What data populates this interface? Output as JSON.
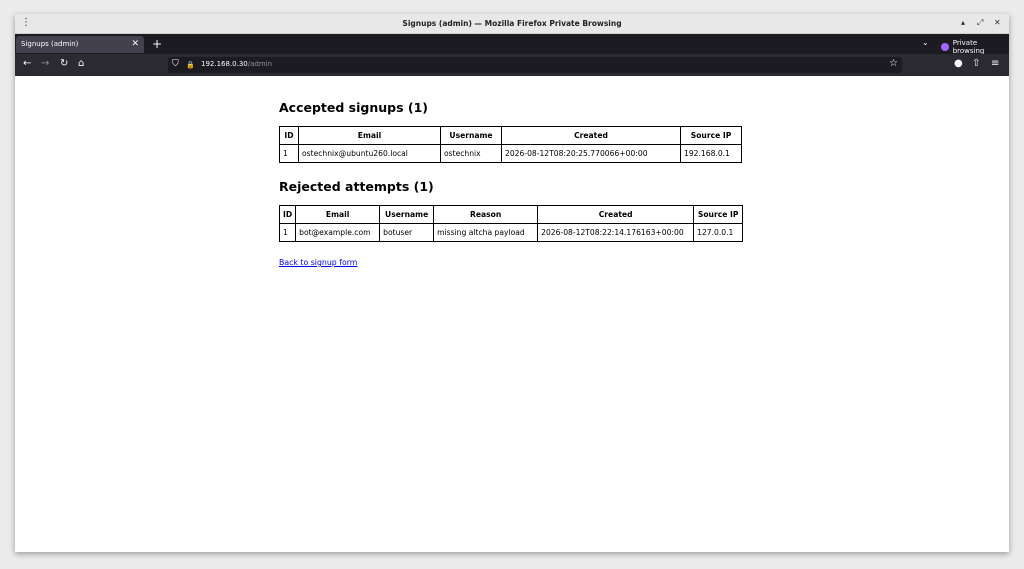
{
  "window": {
    "title": "Signups (admin) — Mozilla Firefox Private Browsing",
    "menu_icon": "⋮",
    "minimize_icon": "▴",
    "maximize_icon": "⤢",
    "close_icon": "✕"
  },
  "tabs": {
    "active_label": "Signups (admin)",
    "close_icon": "✕",
    "new_tab_icon": "+",
    "list_icon": "⌄",
    "private_label": "Private browsing"
  },
  "nav": {
    "back_icon": "←",
    "forward_icon": "→",
    "reload_icon": "↻",
    "home_icon": "⌂",
    "shield_icon": "⛉",
    "lock_icon": "🔒",
    "url_host": "192.168.0.30",
    "url_path": "/admin",
    "bookmark_icon": "☆",
    "extension_icon": "●",
    "puzzle_icon": "⇧",
    "hamburger_icon": "≡"
  },
  "accepted": {
    "heading": "Accepted signups (1)",
    "columns": [
      "ID",
      "Email",
      "Username",
      "Created",
      "Source IP"
    ],
    "rows": [
      [
        "1",
        "ostechnix@ubuntu260.local",
        "ostechnix",
        "2026-08-12T08:20:25.770066+00:00",
        "192.168.0.1"
      ]
    ]
  },
  "rejected": {
    "heading": "Rejected attempts (1)",
    "columns": [
      "ID",
      "Email",
      "Username",
      "Reason",
      "Created",
      "Source IP"
    ],
    "rows": [
      [
        "1",
        "bot@example.com",
        "botuser",
        "missing altcha payload",
        "2026-08-12T08:22:14.176163+00:00",
        "127.0.0.1"
      ]
    ]
  },
  "back_link": "Back to signup form"
}
